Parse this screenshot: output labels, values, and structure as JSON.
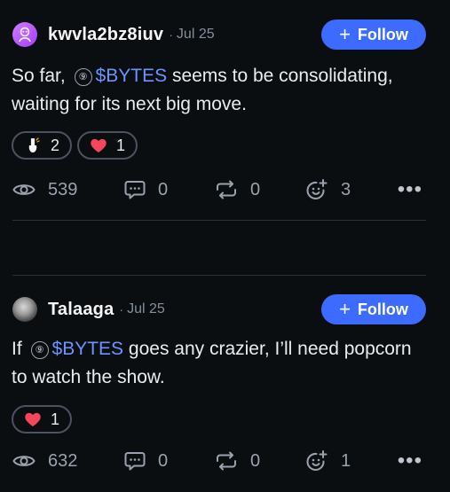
{
  "posts": [
    {
      "username": "kwvla2bz8iuv",
      "separator": "·",
      "date": "Jul 25",
      "follow_label": "Follow",
      "follow_plus": "+",
      "content": {
        "before": "So far,",
        "coin_glyph": "⑨",
        "cashtag": "$BYTES",
        "after": "seems to be consolidating, waiting for its next big move."
      },
      "reactions": [
        {
          "emoji": "pray-hands-emoji",
          "count": "2"
        },
        {
          "emoji": "red-heart-emoji",
          "count": "1"
        }
      ],
      "stats": {
        "views": "539",
        "comments": "0",
        "reposts": "0",
        "tips": "3"
      },
      "more": "•••"
    },
    {
      "username": "Talaaga",
      "separator": "·",
      "date": "Jul 25",
      "follow_label": "Follow",
      "follow_plus": "+",
      "content": {
        "before": "If",
        "coin_glyph": "⑨",
        "cashtag": "$BYTES",
        "after": "goes any crazier, I’ll need popcorn to watch the show."
      },
      "reactions": [
        {
          "emoji": "red-heart-emoji",
          "count": "1"
        }
      ],
      "stats": {
        "views": "632",
        "comments": "0",
        "reposts": "0",
        "tips": "1"
      },
      "more": "•••"
    }
  ],
  "colors": {
    "background": "#0b0e11",
    "accent": "#3d6bff",
    "cashtag": "#6c94ff",
    "muted": "#848e9c",
    "heart": "#f6465d"
  }
}
